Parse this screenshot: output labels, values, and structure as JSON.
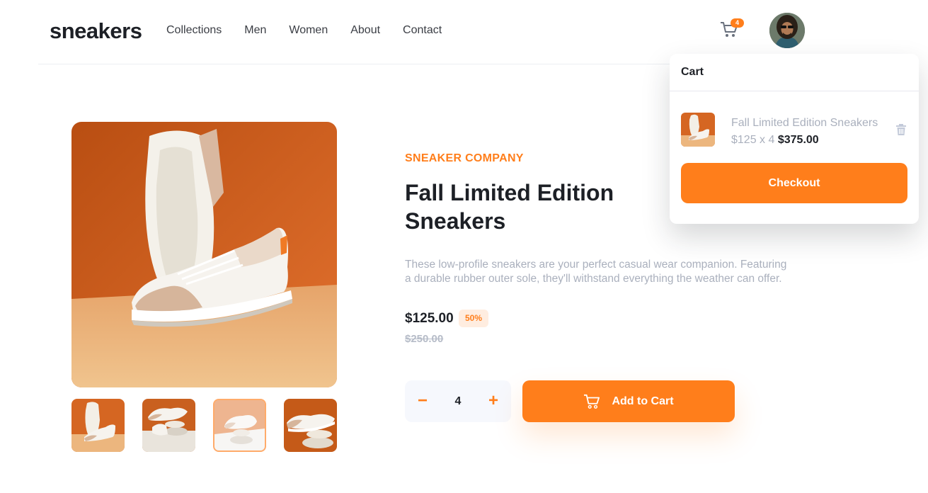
{
  "header": {
    "logo": "sneakers",
    "nav": [
      "Collections",
      "Men",
      "Women",
      "About",
      "Contact"
    ],
    "cart_icon": "cart-icon",
    "cart_count": "4",
    "avatar_icon": "user-avatar"
  },
  "gallery": {
    "active_thumbnail": 3,
    "thumbnails": [
      "thumbnail-1",
      "thumbnail-2",
      "thumbnail-3",
      "thumbnail-4"
    ]
  },
  "product": {
    "company": "SNEAKER COMPANY",
    "title": "Fall Limited Edition Sneakers",
    "description": "These low-profile sneakers are your perfect casual wear companion. Featuring a durable rubber outer sole, they'll withstand everything the weather can offer.",
    "price": "$125.00",
    "discount": "50%",
    "old_price": "$250.00"
  },
  "quantity": {
    "minus": "−",
    "value": "4",
    "plus": "+"
  },
  "add_to_cart": {
    "label": "Add to Cart",
    "icon": "cart-icon"
  },
  "cart": {
    "title": "Cart",
    "items": [
      {
        "name": "Fall Limited Edition Sneakers",
        "unit": "$125 x 4",
        "total": "$375.00",
        "delete_icon": "trash-icon"
      }
    ],
    "checkout": "Checkout"
  },
  "colors": {
    "accent": "#ff7e1b",
    "accent_light": "#ffede0",
    "text_dark": "#1d2026",
    "text_muted": "#aab0bd"
  }
}
